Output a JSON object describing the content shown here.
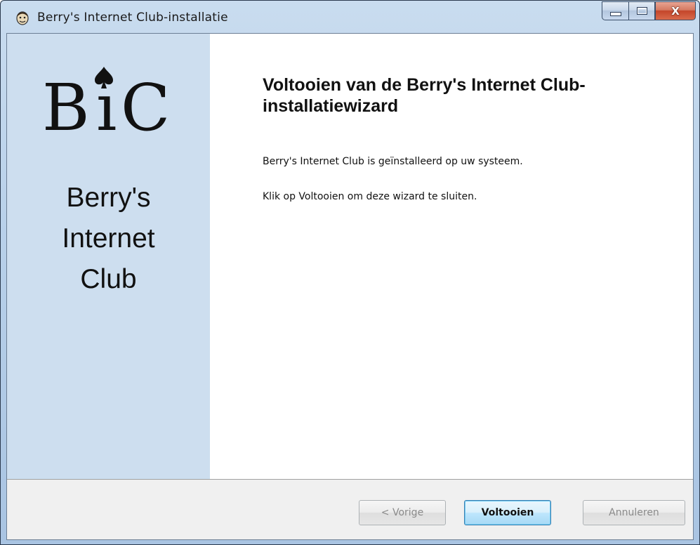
{
  "window": {
    "title": "Berry's Internet Club-installatie",
    "caption_buttons": {
      "minimize_icon": "minimize-icon",
      "maximize_icon": "maximize-icon",
      "close_icon": "close-icon",
      "close_glyph": "X"
    }
  },
  "sidebar": {
    "logo": {
      "letter_b": "B",
      "letter_i": "ı",
      "letter_c": "C",
      "icon": "spade-icon"
    },
    "brand_lines": [
      "Berry's",
      "Internet",
      "Club"
    ]
  },
  "content": {
    "heading": "Voltooien van de Berry's Internet Club-installatiewizard",
    "paragraphs": [
      "Berry's Internet Club is geïnstalleerd op uw systeem.",
      "Klik op Voltooien om deze wizard te sluiten."
    ]
  },
  "footer": {
    "back_label": "< Vorige",
    "finish_label": "Voltooien",
    "cancel_label": "Annuleren"
  },
  "colors": {
    "sidebar_bg": "#cddeef",
    "content_bg": "#ffffff",
    "footer_bg": "#f0f0f0",
    "default_button_border": "#3c7fb1"
  }
}
